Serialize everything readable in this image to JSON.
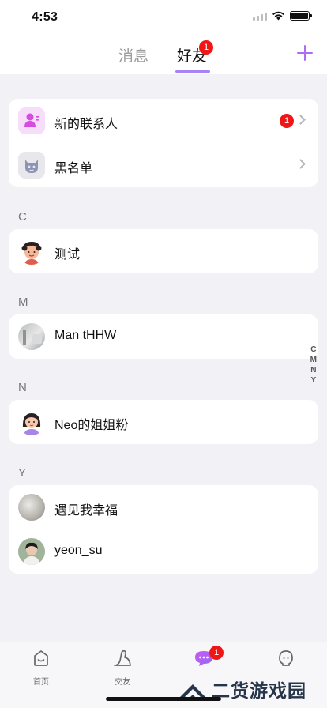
{
  "status": {
    "time": "4:53"
  },
  "header": {
    "tabs": [
      {
        "label": "消息",
        "active": false
      },
      {
        "label": "好友",
        "active": true,
        "badge": "1"
      }
    ],
    "accent": "#a684f5"
  },
  "special_rows": [
    {
      "label": "新的联系人",
      "badge": "1"
    },
    {
      "label": "黑名单"
    }
  ],
  "sections": [
    {
      "letter": "C",
      "contacts": [
        {
          "name": "测试"
        }
      ]
    },
    {
      "letter": "M",
      "contacts": [
        {
          "name": "Man tHHW"
        }
      ]
    },
    {
      "letter": "N",
      "contacts": [
        {
          "name": "Neo的姐姐粉"
        }
      ]
    },
    {
      "letter": "Y",
      "contacts": [
        {
          "name": "遇见我幸福"
        },
        {
          "name": "yeon_su"
        }
      ]
    }
  ],
  "index_letters": [
    "C",
    "M",
    "N",
    "Y"
  ],
  "tabbar": {
    "items": [
      {
        "label": "首页",
        "icon": "home-face-icon"
      },
      {
        "label": "交友",
        "icon": "dinosaur-icon"
      },
      {
        "label": "",
        "icon": "chat-bubble-icon",
        "badge": "1"
      },
      {
        "label": "",
        "icon": "person-icon"
      }
    ]
  },
  "watermark": {
    "text": "二货游戏园"
  }
}
